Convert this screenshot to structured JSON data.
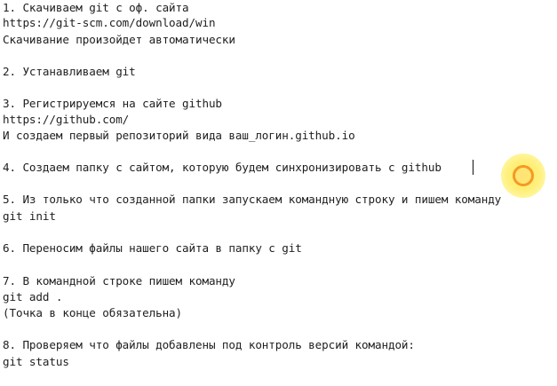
{
  "document": {
    "lines": [
      "1. Скачиваем git с оф. сайта",
      "https://git-scm.com/download/win",
      "Скачивание произойдет автоматически",
      "2. Устанавливаем git",
      "3. Регистрируемся на сайте github",
      "https://github.com/",
      "И создаем первый репозиторий вида ваш_логин.github.io",
      "4. Создаем папку с сайтом, которую будем синхронизировать с github",
      "5. Из только что созданной папки запускаем командную строку и пишем команду",
      "git init",
      "6. Переносим файлы нашего сайта в папку с git",
      "7. В командной строке пишем команду",
      "git add .",
      "(Точка в конце обязательна)",
      "8. Проверяем что файлы добавлены под контроль версий командой:",
      "git status"
    ]
  },
  "cursor": {
    "highlight_color": "#ffef77",
    "ring_color": "#f49a24"
  }
}
